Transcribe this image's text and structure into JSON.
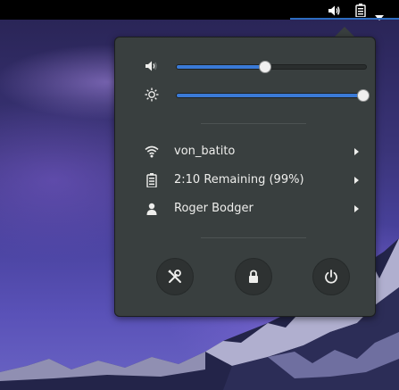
{
  "topbar": {
    "volume_icon": "audio-volume-icon",
    "battery_icon": "battery-icon",
    "dropdown_icon": "chevron-down-icon"
  },
  "menu": {
    "volume": {
      "icon": "audio-volume-medium-icon",
      "level": 0.46
    },
    "brightness": {
      "icon": "brightness-icon",
      "level": 1.0
    },
    "items": [
      {
        "icon": "wifi-icon",
        "label": "von_batito"
      },
      {
        "icon": "battery-icon",
        "label": "2:10 Remaining (99%)"
      },
      {
        "icon": "user-icon",
        "label": "Roger Bodger"
      }
    ],
    "buttons": [
      {
        "icon": "settings-icon"
      },
      {
        "icon": "lock-icon"
      },
      {
        "icon": "power-icon"
      }
    ]
  },
  "colors": {
    "accent": "#3a7ad6",
    "menu_bg": "#393f3f",
    "text": "#eeeeec"
  }
}
